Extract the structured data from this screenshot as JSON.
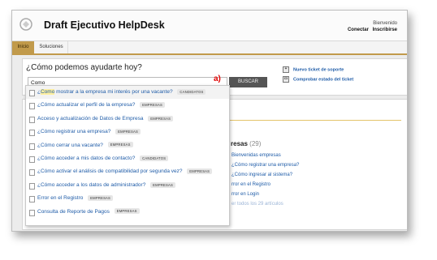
{
  "header": {
    "title": "Draft Ejecutivo HelpDesk",
    "welcome": "Bienvenido",
    "connect": "Conectar",
    "signup": "Inscribirse"
  },
  "nav": {
    "tabs": [
      "Inicio",
      "Soluciones"
    ]
  },
  "search": {
    "heading": "¿Cómo podemos ayudarte hoy?",
    "value": "Como",
    "button": "BUSCAR",
    "annotation": "a)"
  },
  "quick_links": [
    "Nuevo ticket de soporte",
    "Comprobar estado del ticket"
  ],
  "suggestions": [
    {
      "pre": "¿",
      "hl": "Como",
      "post": " mostrar a la empresa mi interés por una vacante?",
      "tag": "CANDIDATOS"
    },
    {
      "pre": "¿Cómo actualizar el perfil de la empresa?",
      "hl": "",
      "post": "",
      "tag": "EMPRESAS"
    },
    {
      "pre": "Acceso y actualización de Datos de Empresa",
      "hl": "",
      "post": "",
      "tag": "EMPRESAS"
    },
    {
      "pre": "¿Cómo registrar una empresa?",
      "hl": "",
      "post": "",
      "tag": "EMPRESAS"
    },
    {
      "pre": "¿Cómo cerrar una vacante?",
      "hl": "",
      "post": "",
      "tag": "EMPRESAS"
    },
    {
      "pre": "¿Cómo acceder a mis datos de contacto?",
      "hl": "",
      "post": "",
      "tag": "CANDIDATOS"
    },
    {
      "pre": "¿Cómo activar el análisis de compatibilidad por segunda vez?",
      "hl": "",
      "post": "",
      "tag": "EMPRESAS"
    },
    {
      "pre": "¿Cómo acceder a los datos de administrador?",
      "hl": "",
      "post": "",
      "tag": "EMPRESAS"
    },
    {
      "pre": "Error en el Registro",
      "hl": "",
      "post": "",
      "tag": "EMPRESAS"
    },
    {
      "pre": "Consulta de Reporte de Pagos",
      "hl": "",
      "post": "",
      "tag": "EMPRESAS"
    }
  ],
  "side": {
    "heading": "resas",
    "count": "(29)",
    "links": [
      "Bienvenidas empresas",
      "¿Cómo registrar una empresa?",
      "¿Cómo ingresar al sistema?",
      "rror en el Registro",
      "rror en Login"
    ],
    "more": "er todos los 29 artículos"
  },
  "colors": {
    "accent": "#c19a4b",
    "link": "#1f5ca8",
    "annotation": "#e10000"
  }
}
